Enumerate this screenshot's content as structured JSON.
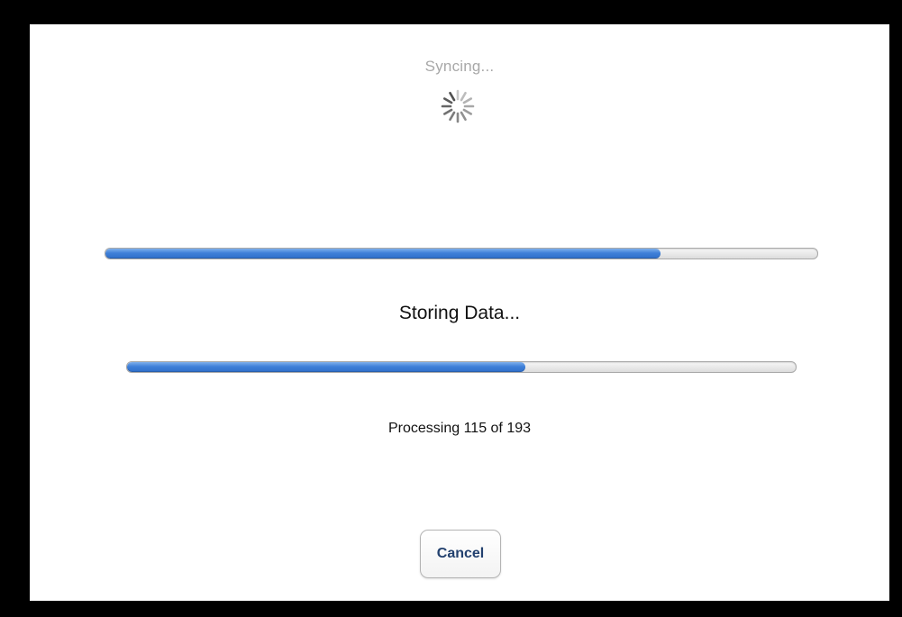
{
  "sync": {
    "label": "Syncing..."
  },
  "overall_progress": {
    "fraction": 0.78
  },
  "status": {
    "message": "Storing Data...",
    "count_text": "Processing 115 of 193"
  },
  "detail_progress": {
    "current": 115,
    "total": 193
  },
  "actions": {
    "cancel_label": "Cancel"
  },
  "colors": {
    "progress_fill": "#3f80d8",
    "cancel_text": "#23416f",
    "sync_text": "#a8a8a8"
  },
  "icons": {
    "spinner": "activity-spinner-icon"
  }
}
